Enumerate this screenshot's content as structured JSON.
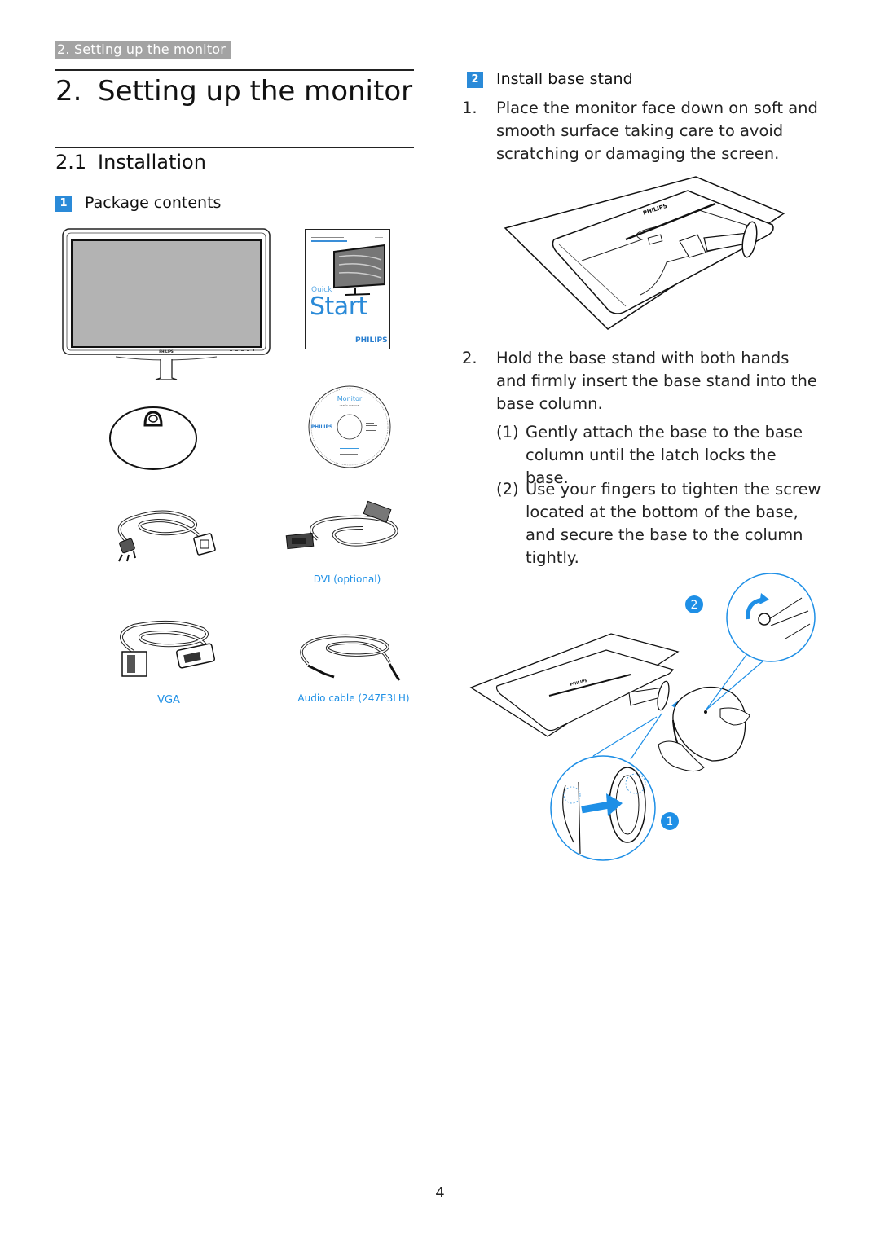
{
  "running_head": "2. Setting up the monitor",
  "chapter": {
    "number": "2.",
    "title": "Setting up the monitor"
  },
  "section": {
    "number": "2.1",
    "title": "Installation"
  },
  "package_contents": {
    "badge": "1",
    "heading": "Package contents",
    "quick_start": {
      "small": "Quick",
      "large": "Start",
      "brand": "PHILIPS"
    },
    "cd": {
      "title": "Monitor",
      "subtitle": "user's manual",
      "brand": "PHILIPS"
    },
    "monitor_brand": "PHILIPS",
    "captions": {
      "dvi": "DVI (optional)",
      "vga": "VGA",
      "audio": "Audio cable (247E3LH)"
    }
  },
  "install_base": {
    "badge": "2",
    "heading": "Install base stand",
    "steps": [
      {
        "num": "1.",
        "text": "Place the monitor face down on soft and smooth surface taking care to avoid scratching or damaging the screen."
      },
      {
        "num": "2.",
        "text": "Hold the base stand with both hands and firmly insert the base stand into the base column."
      }
    ],
    "substeps": [
      {
        "num": "(1)",
        "text": "Gently attach the base to the base column until the latch locks the base."
      },
      {
        "num": "(2)",
        "text": "Use your fingers to tighten the screw located at the bottom of the base, and secure the base to the column tightly."
      }
    ],
    "callouts": [
      "1",
      "2"
    ],
    "brand": "PHILIPS"
  },
  "page_number": "4",
  "colors": {
    "accent": "#2a8ad8",
    "caption": "#1e90e6",
    "running_head_bg": "#a3a3a3",
    "screen": "#b3b3b3"
  }
}
